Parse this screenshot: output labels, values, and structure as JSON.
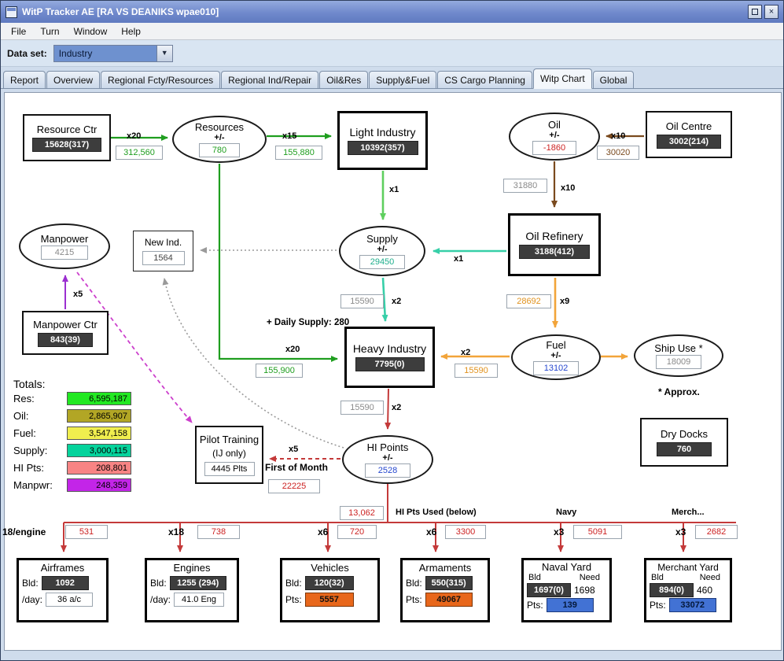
{
  "window": {
    "title": "WitP Tracker AE [RA VS DEANIKS wpae010]"
  },
  "menu": {
    "items": [
      "File",
      "Turn",
      "Window",
      "Help"
    ]
  },
  "dataset": {
    "label": "Data set:",
    "value": "Industry"
  },
  "tabs": {
    "items": [
      "Report",
      "Overview",
      "Regional Fcty/Resources",
      "Regional Ind/Repair",
      "Oil&Res",
      "Supply&Fuel",
      "CS Cargo Planning",
      "Witp Chart",
      "Global"
    ],
    "selected": "Witp Chart"
  },
  "nodes": {
    "resource_ctr": {
      "title": "Resource Ctr",
      "value": "15628(317)"
    },
    "resources": {
      "title": "Resources",
      "sub": "+/-",
      "value": "780"
    },
    "light_industry": {
      "title": "Light Industry",
      "value": "10392(357)"
    },
    "oil": {
      "title": "Oil",
      "sub": "+/-",
      "value": "-1860"
    },
    "oil_centre": {
      "title": "Oil Centre",
      "value": "3002(214)"
    },
    "oil_refinery": {
      "title": "Oil Refinery",
      "value": "3188(412)"
    },
    "supply": {
      "title": "Supply",
      "sub": "+/-",
      "value": "29450"
    },
    "manpower": {
      "title": "Manpower",
      "value": "4215"
    },
    "new_ind": {
      "title": "New Ind.",
      "value": "1564"
    },
    "manpower_ctr": {
      "title": "Manpower Ctr",
      "value": "843(39)"
    },
    "heavy_industry": {
      "title": "Heavy Industry",
      "value": "7795(0)"
    },
    "fuel": {
      "title": "Fuel",
      "sub": "+/-",
      "value": "13102"
    },
    "ship_use": {
      "title": "Ship Use *",
      "value": "18009",
      "note": "* Approx."
    },
    "pilot_training": {
      "title": "Pilot Training",
      "sub": "(IJ only)",
      "value": "4445 Plts"
    },
    "hi_points": {
      "title": "HI Points",
      "sub": "+/-",
      "value": "2528"
    },
    "dry_docks": {
      "title": "Dry Docks",
      "value": "760"
    }
  },
  "edges": {
    "res_ctr_to_resources": {
      "mult": "x20",
      "value": "312,560"
    },
    "resources_to_light": {
      "mult": "x15",
      "value": "155,880"
    },
    "oil_centre_to_oil": {
      "mult": "x10",
      "value": "30020"
    },
    "oil_to_refinery": {
      "mult": "x10",
      "value": "31880"
    },
    "light_to_supply": {
      "mult": "x1"
    },
    "refinery_to_supply": {
      "mult": "x1"
    },
    "supply_to_heavy": {
      "mult": "x2",
      "value": "15590"
    },
    "daily_supply": "+ Daily Supply: 280",
    "resources_to_heavy": {
      "mult": "x20",
      "value": "155,900"
    },
    "refinery_to_fuel": {
      "mult": "x9",
      "value": "28692"
    },
    "fuel_to_heavy": {
      "mult": "x2",
      "value": "15590"
    },
    "heavy_to_hi": {
      "mult": "x2",
      "value": "15590"
    },
    "manpower_ctr_to_manpower": {
      "mult": "x5"
    },
    "hi_to_pilot": {
      "mult": "x5"
    },
    "first_of_month": {
      "label": "First of Month",
      "value": "22225"
    },
    "hi_used": {
      "label": "HI Pts Used (below)",
      "value": "13,062"
    },
    "navy_label": "Navy",
    "merch_label": "Merch..."
  },
  "totals": {
    "title": "Totals:",
    "rows": [
      {
        "label": "Res:",
        "value": "6,595,187",
        "color": "#22e822"
      },
      {
        "label": "Oil:",
        "value": "2,865,907",
        "color": "#b2a625"
      },
      {
        "label": "Fuel:",
        "value": "3,547,158",
        "color": "#f0ee4e"
      },
      {
        "label": "Supply:",
        "value": "3,000,115",
        "color": "#06d39c"
      },
      {
        "label": "HI Pts:",
        "value": "208,801",
        "color": "#f88484"
      },
      {
        "label": "Manpwr:",
        "value": "248,359",
        "color": "#c325e8"
      }
    ]
  },
  "distribution": [
    {
      "mult": "18/engine",
      "value": "531"
    },
    {
      "mult": "x18",
      "value": "738"
    },
    {
      "mult": "x6",
      "value": "720"
    },
    {
      "mult": "x6",
      "value": "3300"
    },
    {
      "mult": "x3",
      "value": "5091"
    },
    {
      "mult": "x3",
      "value": "2682"
    }
  ],
  "factories": {
    "airframes": {
      "title": "Airframes",
      "r1_label": "Bld:",
      "r1_value": "1092",
      "r2_label": "/day:",
      "r2_value": "36 a/c"
    },
    "engines": {
      "title": "Engines",
      "r1_label": "Bld:",
      "r1_value": "1255 (294)",
      "r2_label": "/day:",
      "r2_value": "41.0 Eng"
    },
    "vehicles": {
      "title": "Vehicles",
      "r1_label": "Bld:",
      "r1_value": "120(32)",
      "r2_label": "Pts:",
      "r2_value": "5557"
    },
    "armaments": {
      "title": "Armaments",
      "r1_label": "Bld:",
      "r1_value": "550(315)",
      "r2_label": "Pts:",
      "r2_value": "49067"
    },
    "naval_yard": {
      "title": "Naval Yard",
      "bld_header": "Bld",
      "need_header": "Need",
      "bld": "1697(0)",
      "need": "1698",
      "pts_label": "Pts:",
      "pts": "139"
    },
    "merchant_yard": {
      "title": "Merchant Yard",
      "bld_header": "Bld",
      "need_header": "Need",
      "bld": "894(0)",
      "need": "460",
      "pts_label": "Pts:",
      "pts": "33072"
    }
  },
  "colors": {
    "green": "#1f9e1f",
    "light_green": "#5ecf5e",
    "brown": "#7a4a1e",
    "teal": "#37cfa8",
    "orange": "#f2a43a",
    "red": "#c43a3a",
    "purple": "#9b2fd0",
    "magenta": "#cc3fcc",
    "gray": "#9a9a9a",
    "pts_orange": "#e8671b",
    "pts_blue": "#4272d4",
    "dark_box": "#3d3d3d"
  }
}
